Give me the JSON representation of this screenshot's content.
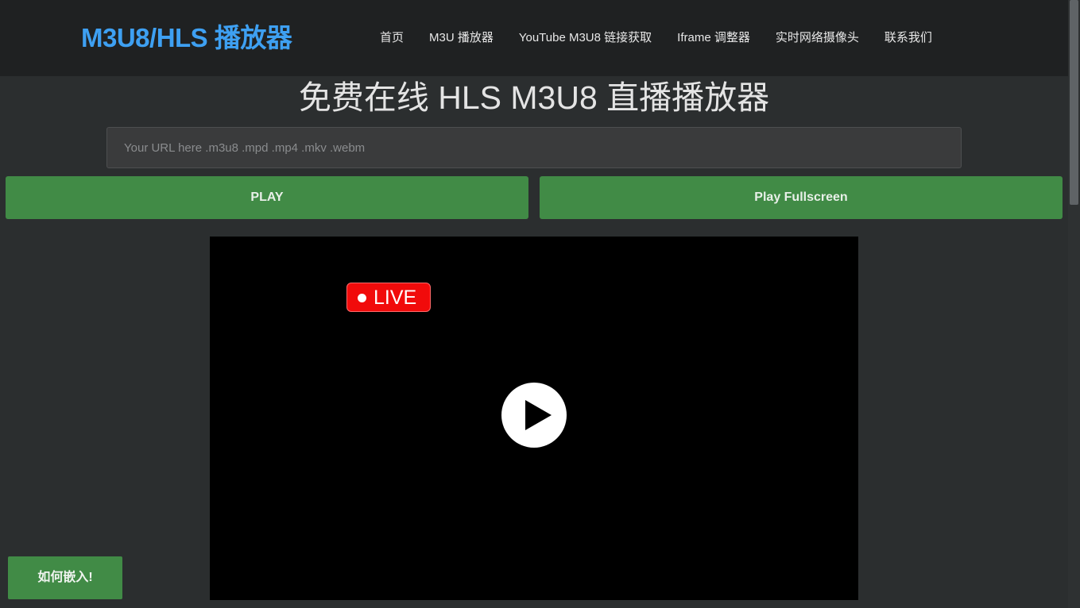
{
  "header": {
    "brand": "M3U8/HLS 播放器",
    "nav": [
      {
        "label": "首页"
      },
      {
        "label": "M3U 播放器"
      },
      {
        "label": "YouTube M3U8 链接获取"
      },
      {
        "label": "Iframe 调整器"
      },
      {
        "label": "实时网络摄像头"
      },
      {
        "label": "联系我们"
      }
    ]
  },
  "main": {
    "title": "免费在线 HLS M3U8 直播播放器",
    "url_input": {
      "value": "",
      "placeholder": "Your URL here .m3u8 .mpd .mp4 .mkv .webm"
    },
    "play_button": "PLAY",
    "fullscreen_button": "Play Fullscreen"
  },
  "player": {
    "live_badge": "LIVE",
    "play_icon": "play-icon"
  },
  "embed_button": "如何嵌入!",
  "colors": {
    "brand": "#3ea0f2",
    "button_green": "#418b46",
    "live_red": "#f10b0b",
    "header_bg": "#1f2122",
    "page_bg": "#2b2e2f"
  }
}
